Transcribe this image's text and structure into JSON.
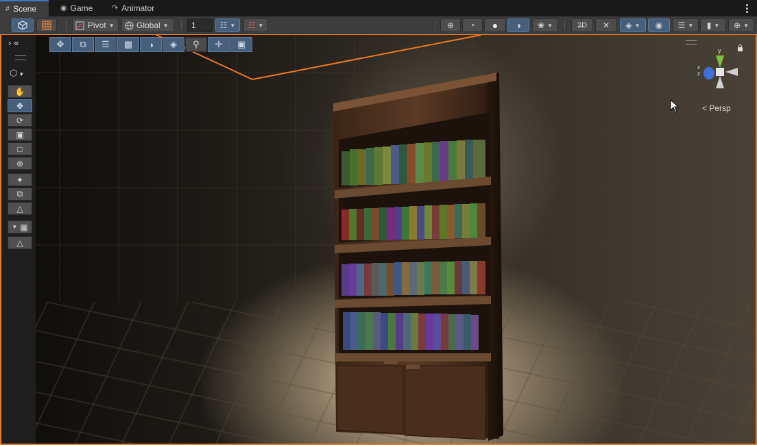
{
  "tabs": [
    {
      "label": "Scene",
      "icon": "grid-icon",
      "active": true
    },
    {
      "label": "Game",
      "icon": "gamepad-icon",
      "active": false
    },
    {
      "label": "Animator",
      "icon": "animator-icon",
      "active": false
    }
  ],
  "toolbar": {
    "pivot_label": "Pivot",
    "global_label": "Global",
    "grid_increment": "1"
  },
  "viewport": {
    "projection_label": "Persp",
    "gizmo_axes": {
      "x": "x",
      "y": "y",
      "z": "z"
    }
  },
  "colors": {
    "selection_outline": "#f07b1b",
    "active_button": "#46607c",
    "gizmo_y": "#7fc241",
    "gizmo_z": "#3f6fd8"
  }
}
